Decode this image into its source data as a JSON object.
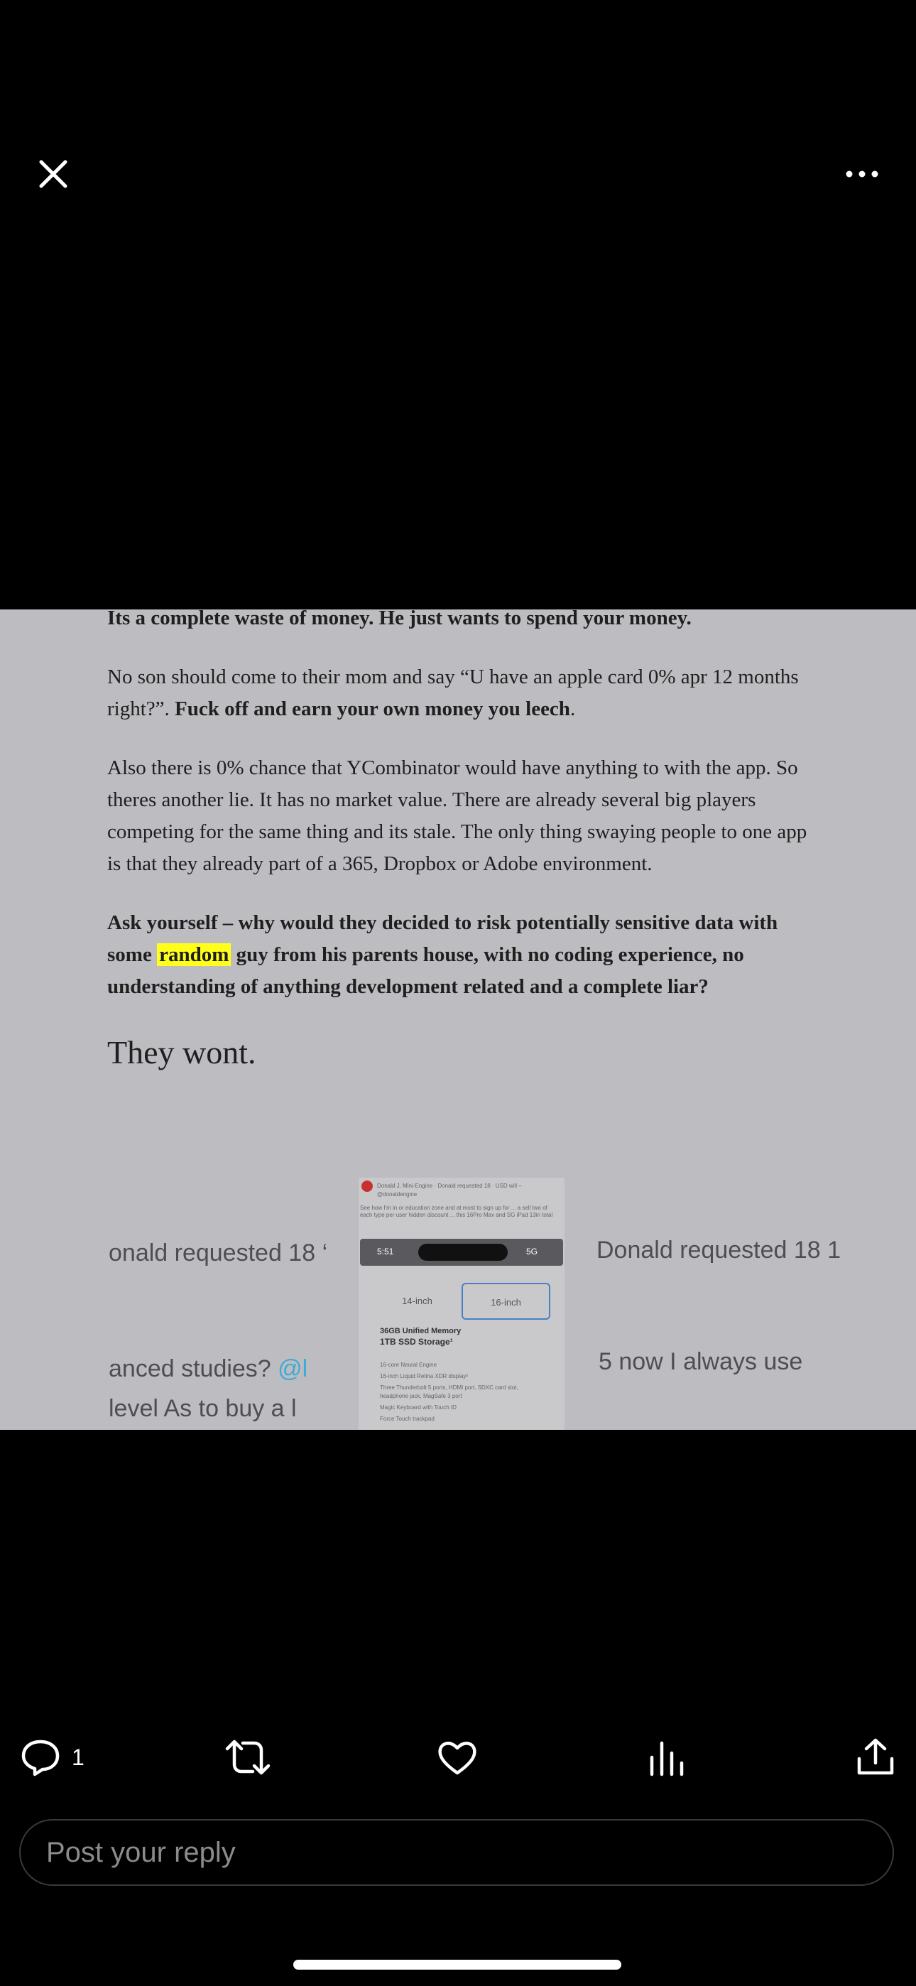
{
  "topbar": {
    "close_icon": "close-icon",
    "more_icon": "more-horizontal-icon"
  },
  "document": {
    "line1": "Its a complete waste of money. He just wants to spend your money.",
    "p1_normal": "No son should come to their mom and say “U have an apple card 0% apr 12 months right?”. ",
    "p1_bold": "Fuck off and earn your own money you leech",
    "p1_end": ".",
    "p2": "Also there is 0% chance that YCombinator would have anything to with the app. So theres another lie. It has no market value. There are already several big players competing for the same thing and its stale. The only thing swaying people to one app is that they already part of a 365, Dropbox or Adobe environment.",
    "p3_before": "Ask yourself – why would they decided to risk potentially sensitive data with some ",
    "p3_highlight": "random",
    "p3_after": " guy from his parents house, with no coding experience, no understanding of anything development related and a complete liar?",
    "p4": "They wont."
  },
  "embedded": {
    "left1": "onald requested 18 ‘",
    "left2_text": "anced studies? ",
    "left2_link": "@l",
    "left3": "level As to buy a l",
    "right1": "Donald requested 18 1",
    "right2": "5 now I always use",
    "phone_header": "Donald J. Mini-Engine · Donald requested 18 · USD will – @donaldengine",
    "phone_sub": "See how I'm in or education zone and at most to sign up for ... a sell two of each type per user hidden discount ... this 16Pro Max and SG iPad 13in total",
    "phone_time": "5:51",
    "phone_status": "5G",
    "tab1": "14-inch",
    "tab2": "16-inch",
    "memory": "36GB Unified Memory",
    "storage": "1TB SSD Storage¹",
    "specs": [
      "16-core Neural Engine",
      "16-inch Liquid Retina XDR display²",
      "Three Thunderbolt 5 ports, HDMI port, SDXC card slot, headphone jack, MagSafe 3 port",
      "Magic Keyboard with Touch ID",
      "Force Touch trackpad"
    ]
  },
  "actions": {
    "reply_count": "1",
    "icons": [
      "reply-icon",
      "repost-icon",
      "like-icon",
      "views-icon",
      "share-icon"
    ]
  },
  "reply_box": {
    "placeholder": "Post your reply"
  }
}
